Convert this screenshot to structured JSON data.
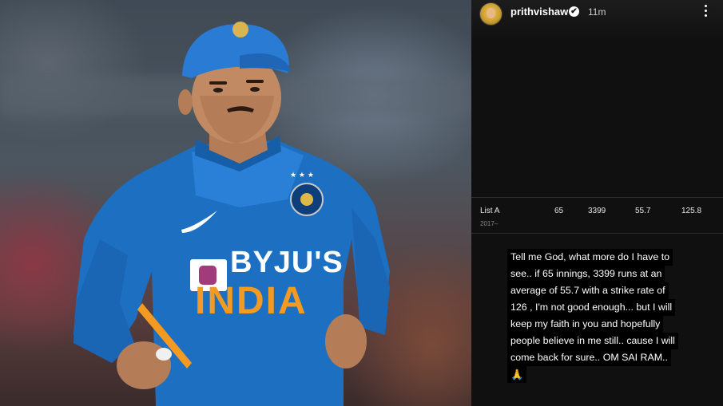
{
  "story": {
    "username": "prithvishaw",
    "verified_mark": "✔",
    "time_ago": "11m",
    "icons": [
      "avatar",
      "verified-icon",
      "more-options-icon",
      "folded-hands-icon"
    ]
  },
  "stats": {
    "label": "List A",
    "years": "2017–",
    "innings": "65",
    "runs": "3399",
    "average": "55.7",
    "strike_rate": "125.8"
  },
  "caption": {
    "lines": [
      "Tell me God, what more do I have to",
      "see.. if 65 innings, 3399 runs at an",
      "average of 55.7 with a strike rate of",
      "126 , I'm not good enough... but I will",
      "keep my faith in you and hopefully",
      "people believe in me still.. cause I will",
      "come back for sure.. OM SAI RAM..",
      "🙏"
    ]
  },
  "photo": {
    "jersey_sponsor": "BYJU'S",
    "jersey_team": "INDIA",
    "colors": {
      "jersey": "#1d6fc2",
      "cap": "#2a7bd4",
      "team_text": "#f39a22"
    }
  }
}
